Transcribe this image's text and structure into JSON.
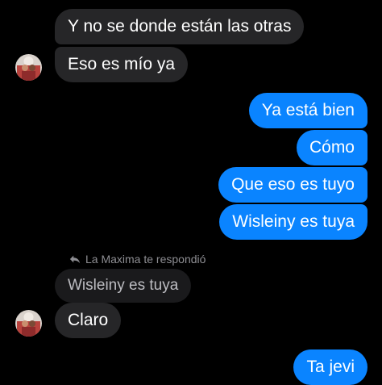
{
  "messages": {
    "m1": "Y no se donde están las otras",
    "m2": "Eso es mío ya",
    "m3": "Ya está bien",
    "m4": "Cómo",
    "m5": "Que eso es tuyo",
    "m6": "Wisleiny es tuya",
    "m7": "Wisleiny es tuya",
    "m8": "Claro",
    "m9": "Ta jevi"
  },
  "reply_note": "La Maxima te respondió",
  "icons": {
    "reply": "reply-arrow-icon",
    "avatar": "contact-avatar"
  },
  "colors": {
    "background": "#000000",
    "incoming_bubble": "#262628",
    "outgoing_bubble": "#0a84ff",
    "meta_text": "#8e8e93"
  }
}
